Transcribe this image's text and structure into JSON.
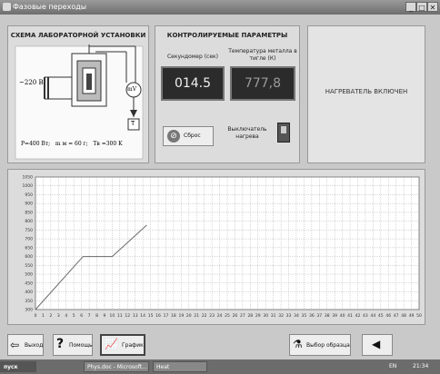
{
  "window": {
    "title": "Фазовые переходы"
  },
  "schema": {
    "title": "СХЕМА ЛАБОРАТОРНОЙ УСТАНОВКИ",
    "voltage": "~220 В",
    "meter": "mV",
    "t_box": "T",
    "params": "P=400 Вт;   m м = 60 г;   Tв =300 K"
  },
  "controls": {
    "title": "КОНТРОЛИРУЕМЫЕ ПАРАМЕТРЫ",
    "stopwatch_label": "Секундомер (сек)",
    "stopwatch_value": "014.5",
    "temp_label": "Температура металла в тигле (К)",
    "temp_value": "777,8",
    "reset_label": "Сброс",
    "switch_label": "Выключатель нагрева"
  },
  "status": {
    "text": "НАГРЕВАТЕЛЬ ВКЛЮЧЕН"
  },
  "chart_data": {
    "type": "line",
    "y_ticks": [
      300,
      350,
      400,
      450,
      500,
      550,
      600,
      650,
      700,
      750,
      800,
      850,
      900,
      950,
      1000,
      1050
    ],
    "x_ticks": [
      0,
      1,
      2,
      3,
      4,
      5,
      6,
      7,
      8,
      9,
      10,
      11,
      12,
      13,
      14,
      15,
      16,
      17,
      18,
      19,
      20,
      21,
      22,
      23,
      24,
      25,
      26,
      27,
      28,
      29,
      30,
      31,
      32,
      33,
      34,
      35,
      36,
      37,
      38,
      39,
      40,
      41,
      42,
      43,
      44,
      45,
      46,
      47,
      48,
      49,
      50
    ],
    "xlim": [
      0,
      50
    ],
    "ylim": [
      300,
      1050
    ],
    "grid": true,
    "series": [
      {
        "x": [
          0,
          6.2,
          10,
          14.5
        ],
        "y": [
          300,
          600,
          600,
          777.8
        ]
      }
    ]
  },
  "toolbar": {
    "exit": "Выход",
    "help": "Помощь",
    "graph": "График",
    "sample": "Выбор образца"
  },
  "taskbar": {
    "start": "пуск",
    "task1": "Phys.doc - Microsoft...",
    "task2": "Heat",
    "lang": "EN",
    "time": "21:34"
  },
  "colors": {
    "line": "#6a6a6a",
    "grid": "#9a9a9a",
    "lcd_bg": "#2b2b2b"
  }
}
